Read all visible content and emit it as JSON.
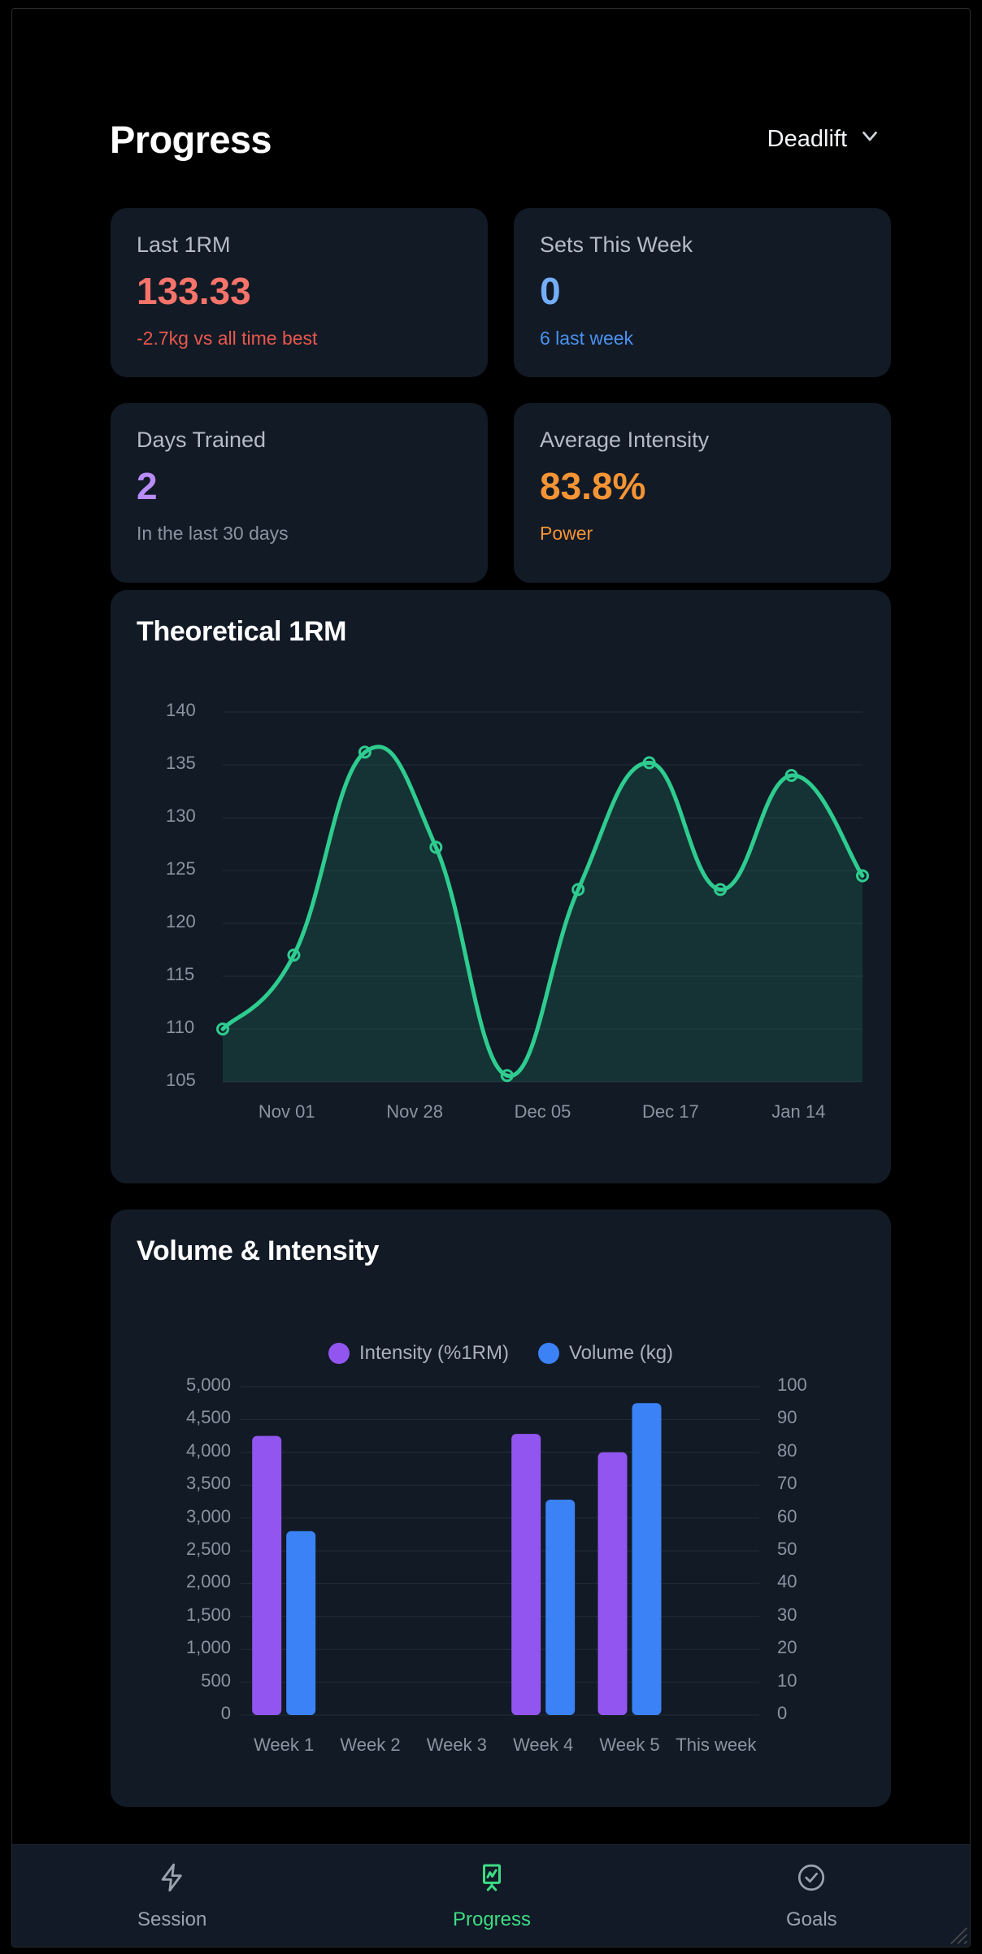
{
  "header": {
    "title": "Progress",
    "exercise": "Deadlift",
    "chevron_icon": "chevron-down-icon"
  },
  "stats": [
    {
      "label": "Last 1RM",
      "value": "133.33",
      "sub": "-2.7kg vs all time best",
      "value_color": "#f8746a",
      "sub_color": "#e8584c"
    },
    {
      "label": "Sets This Week",
      "value": "0",
      "sub": "6 last week",
      "value_color": "#74aef8",
      "sub_color": "#4a92ef"
    },
    {
      "label": "Days Trained",
      "value": "2",
      "sub": "In the last 30 days",
      "value_color": "#b98cf7",
      "sub_color": "#8b93a1"
    },
    {
      "label": "Average Intensity",
      "value": "83.8%",
      "sub": "Power",
      "value_color": "#f59434",
      "sub_color": "#f59434"
    }
  ],
  "line_card": {
    "title": "Theoretical 1RM"
  },
  "bar_card": {
    "title": "Volume & Intensity"
  },
  "navbar": {
    "items": [
      {
        "label": "Session",
        "icon": "lightning-bolt-icon",
        "active": false
      },
      {
        "label": "Progress",
        "icon": "presentation-chart-icon",
        "active": true
      },
      {
        "label": "Goals",
        "icon": "circle-check-icon",
        "active": false
      }
    ]
  },
  "chart_data": [
    {
      "id": "theoretical-1rm",
      "type": "area",
      "title": "Theoretical 1RM",
      "xlabel": "",
      "ylabel": "",
      "x": [
        "Nov 01",
        "Nov 28",
        "Dec 05",
        "Dec 17",
        "Jan 14"
      ],
      "tick_labels": [
        "Nov 01",
        "Nov 28",
        "Dec 05",
        "Dec 17",
        "Jan 14"
      ],
      "ytick_labels": [
        "105",
        "110",
        "115",
        "120",
        "125",
        "130",
        "135",
        "140"
      ],
      "ylim": [
        105,
        140
      ],
      "grid": true,
      "legend": "none",
      "line_color": "#2ecc8f",
      "fill_color": "rgba(46,204,143,0.14)",
      "series": [
        {
          "name": "Theoretical 1RM",
          "points": [
            110.0,
            117.0,
            136.2,
            127.2,
            105.6,
            123.2,
            135.2,
            123.2,
            134.0,
            124.5
          ]
        }
      ]
    },
    {
      "id": "volume-intensity",
      "type": "bar",
      "title": "Volume & Intensity",
      "categories": [
        "Week 1",
        "Week 2",
        "Week 3",
        "Week 4",
        "Week 5",
        "This week"
      ],
      "left_axis": {
        "label": "Volume (kg)",
        "ticks": [
          "0",
          "500",
          "1,000",
          "1,500",
          "2,000",
          "2,500",
          "3,000",
          "3,500",
          "4,000",
          "4,500",
          "5,000"
        ],
        "lim": [
          0,
          5000
        ]
      },
      "right_axis": {
        "label": "Intensity (%1RM)",
        "ticks": [
          "0",
          "10",
          "20",
          "30",
          "40",
          "50",
          "60",
          "70",
          "80",
          "90",
          "100"
        ],
        "lim": [
          0,
          100
        ]
      },
      "grid": true,
      "legend_position": "top-center",
      "series": [
        {
          "name": "Intensity (%1RM)",
          "color": "#9255f0",
          "axis": "right",
          "values": [
            85.0,
            0,
            0,
            85.6,
            80.0,
            0
          ]
        },
        {
          "name": "Volume (kg)",
          "color": "#3b82f6",
          "axis": "left",
          "values": [
            2800,
            0,
            0,
            3280,
            4750,
            0
          ]
        }
      ]
    }
  ]
}
